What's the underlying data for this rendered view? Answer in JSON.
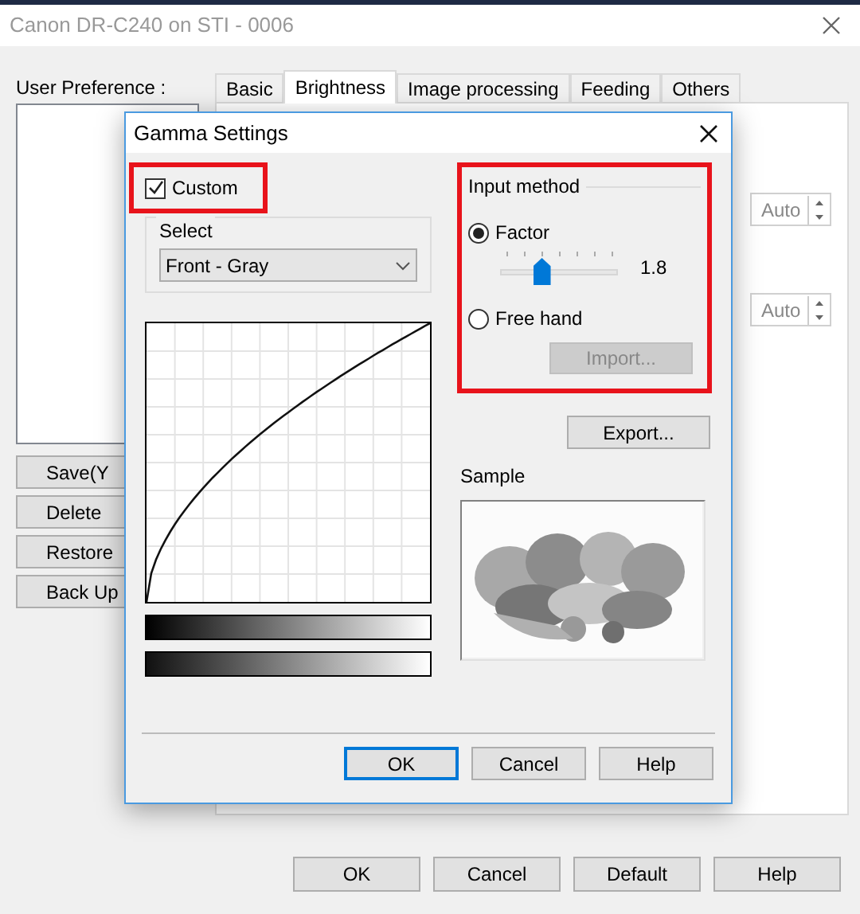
{
  "window": {
    "title": "Canon DR-C240 on STI - 0006"
  },
  "user_preference": {
    "label": "User Preference :",
    "buttons": [
      "Save(Y",
      "Delete",
      "Restore",
      "Back Up"
    ]
  },
  "tabs": [
    {
      "label": "Basic",
      "selected": false
    },
    {
      "label": "Brightness",
      "selected": true
    },
    {
      "label": "Image processing",
      "selected": false
    },
    {
      "label": "Feeding",
      "selected": false
    },
    {
      "label": "Others",
      "selected": false
    }
  ],
  "spin_fields": [
    {
      "value": "Auto",
      "disabled": true
    },
    {
      "value": "Auto",
      "disabled": true
    }
  ],
  "buttons": [
    "OK",
    "Cancel",
    "Default",
    "Help"
  ],
  "dialog": {
    "title": "Gamma Settings",
    "custom": {
      "label": "Custom",
      "checked": true
    },
    "select": {
      "label": "Select",
      "value": "Front - Gray"
    },
    "input_method": {
      "label": "Input method",
      "options": [
        {
          "label": "Factor",
          "selected": true
        },
        {
          "label": "Free hand",
          "selected": false
        }
      ],
      "factor": {
        "level": 0.33,
        "reading": "1.8"
      },
      "import": {
        "label": "Import...",
        "disabled": true
      }
    },
    "export": "Export...",
    "sample_label": "Sample",
    "buttons": [
      {
        "label": "OK",
        "focused": true
      },
      {
        "label": "Cancel",
        "focused": false
      },
      {
        "label": "Help",
        "focused": false
      }
    ]
  }
}
